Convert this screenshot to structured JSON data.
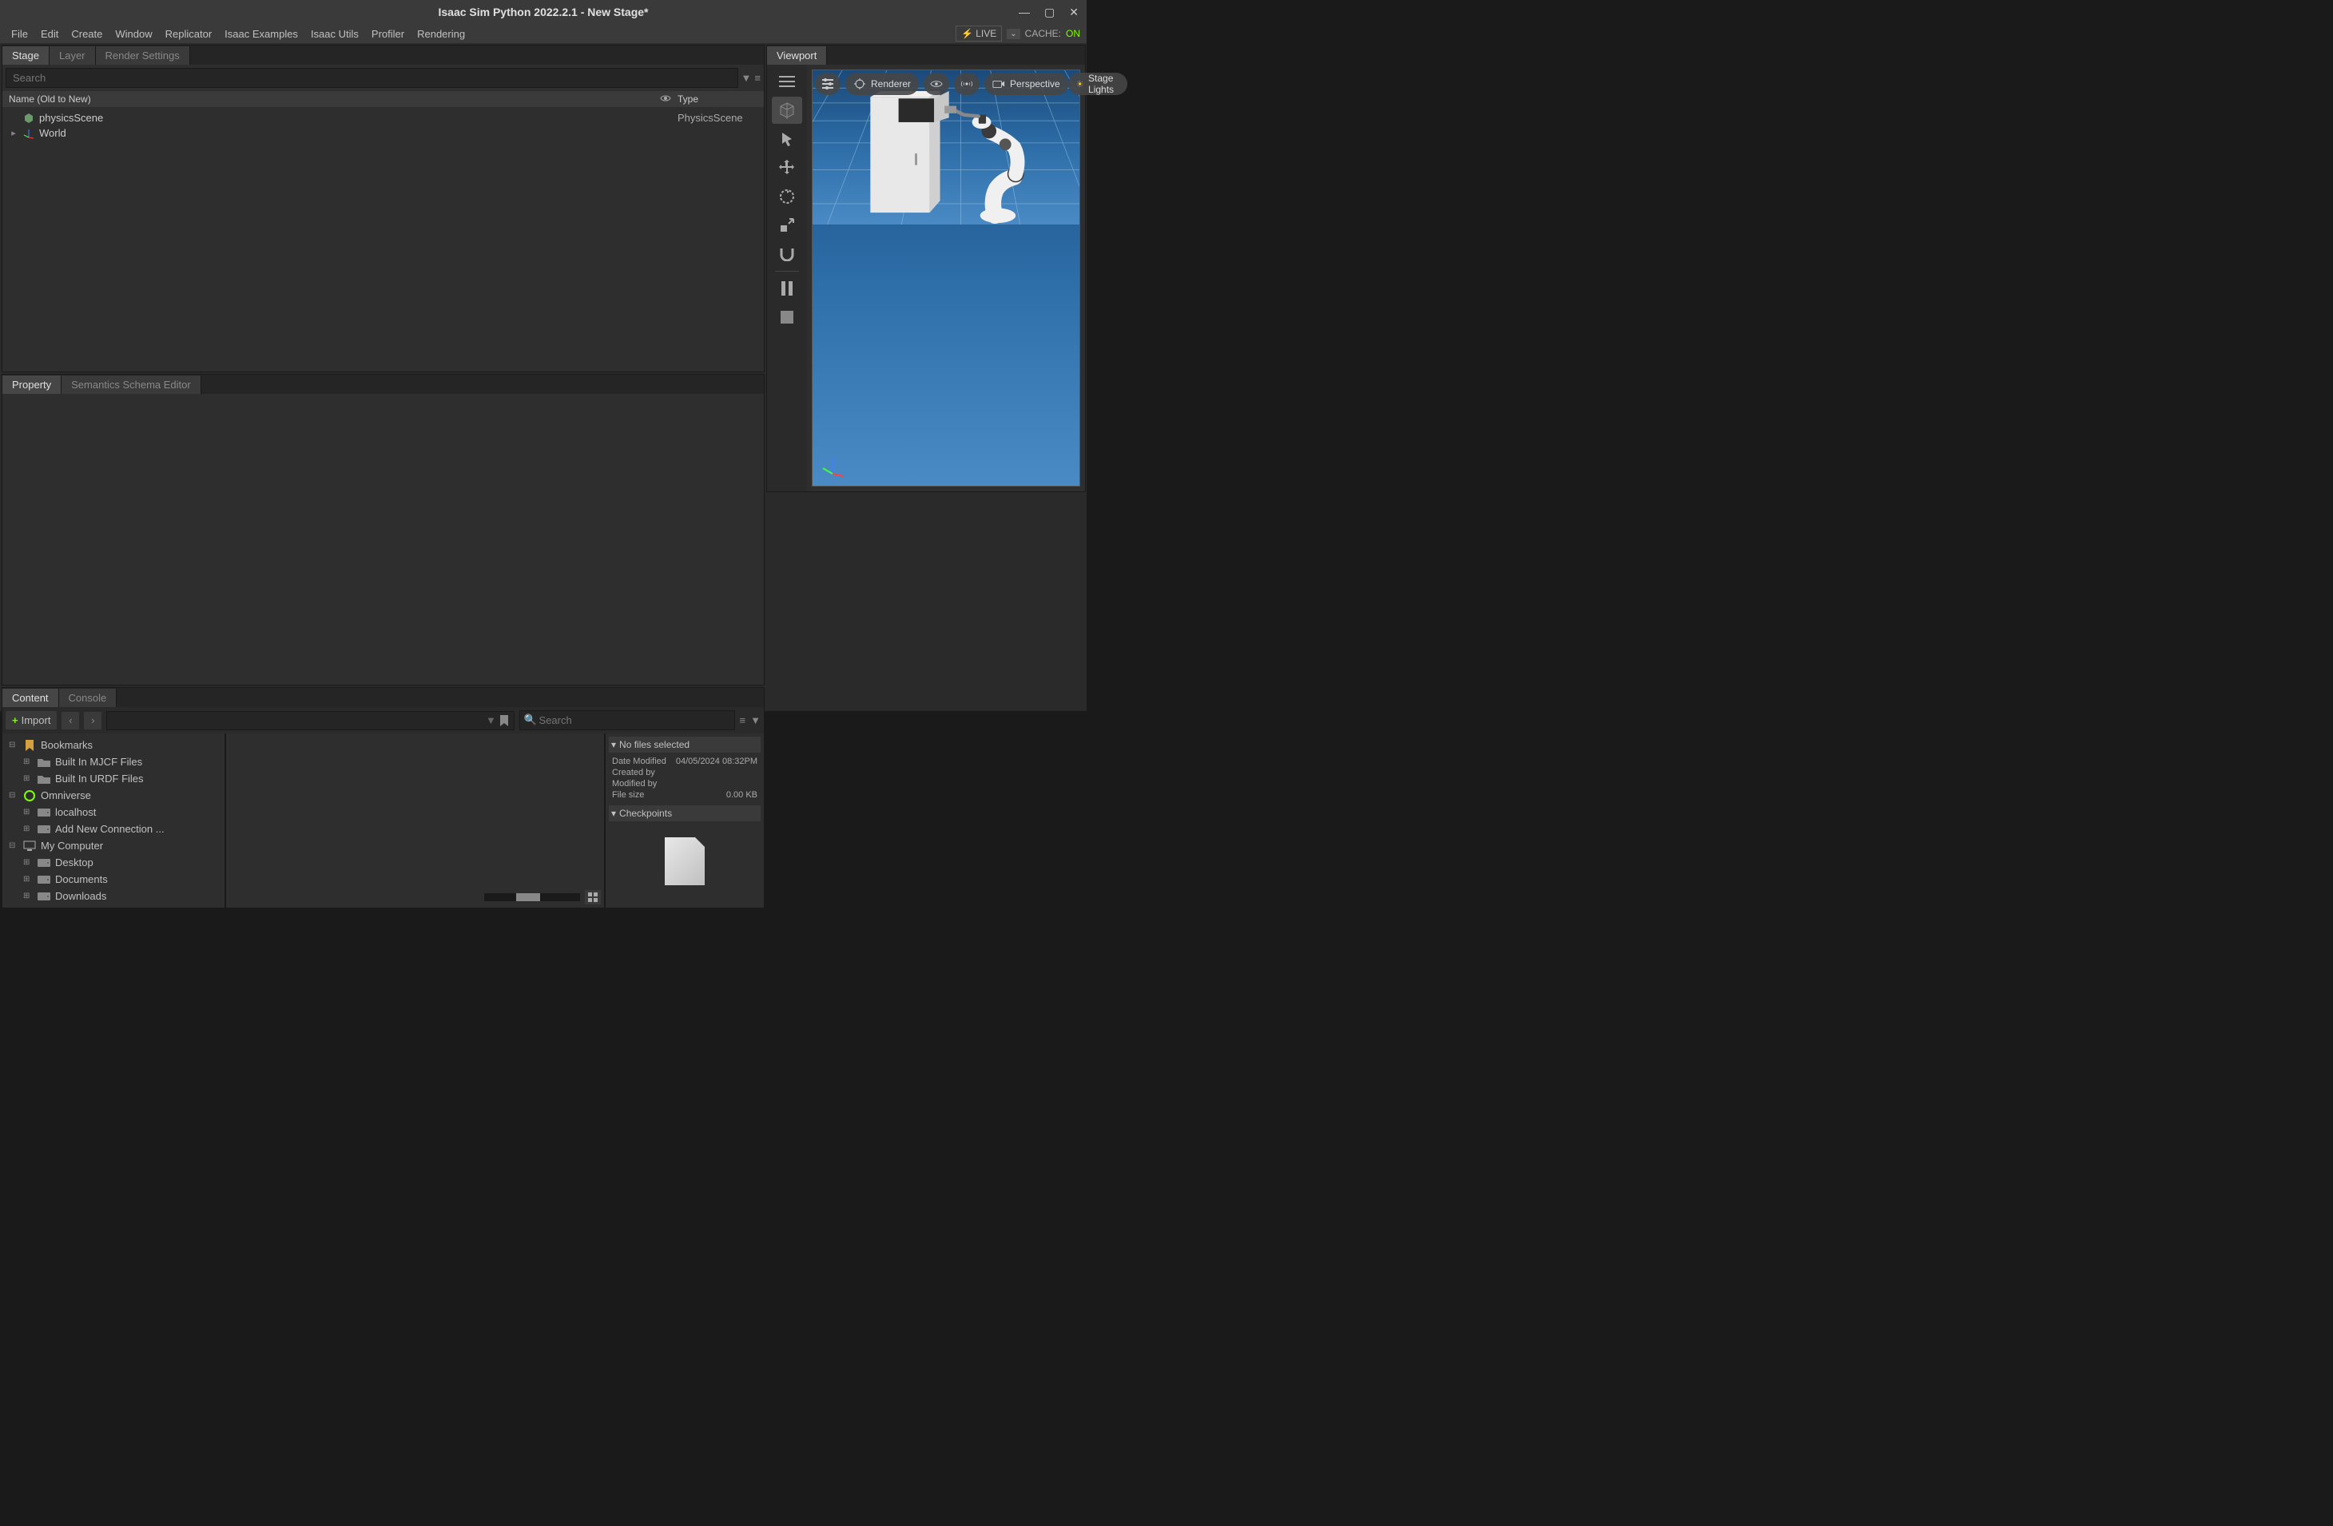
{
  "window": {
    "title": "Isaac Sim Python 2022.2.1 - New Stage*"
  },
  "menubar": {
    "items": [
      "File",
      "Edit",
      "Create",
      "Window",
      "Replicator",
      "Isaac Examples",
      "Isaac Utils",
      "Profiler",
      "Rendering"
    ],
    "live_label": "LIVE",
    "cache_label": "CACHE:",
    "cache_status": "ON"
  },
  "viewport": {
    "tab": "Viewport",
    "renderer_btn": "Renderer",
    "perspective_btn": "Perspective",
    "stage_lights_btn": "Stage Lights"
  },
  "stage_panel": {
    "tabs": [
      "Stage",
      "Layer",
      "Render Settings"
    ],
    "search_placeholder": "Search",
    "col_name": "Name (Old to New)",
    "col_type": "Type",
    "rows": [
      {
        "name": "physicsScene",
        "type": "PhysicsScene",
        "icon": "box"
      },
      {
        "name": "World",
        "type": "",
        "icon": "axes",
        "expandable": true
      }
    ]
  },
  "property_panel": {
    "tabs": [
      "Property",
      "Semantics Schema Editor"
    ]
  },
  "content_panel": {
    "tabs": [
      "Content",
      "Console"
    ],
    "import_btn": "Import",
    "search_placeholder": "Search",
    "tree": [
      {
        "label": "Bookmarks",
        "icon": "bookmark",
        "expanded": true,
        "level": 0
      },
      {
        "label": "Built In MJCF Files",
        "icon": "folder",
        "expandable": true,
        "level": 1
      },
      {
        "label": "Built In URDF Files",
        "icon": "folder",
        "expandable": true,
        "level": 1
      },
      {
        "label": "Omniverse",
        "icon": "omni",
        "expanded": true,
        "level": 0
      },
      {
        "label": "localhost",
        "icon": "drive",
        "expandable": true,
        "level": 1
      },
      {
        "label": "Add New Connection ...",
        "icon": "drive",
        "expandable": true,
        "level": 1
      },
      {
        "label": "My Computer",
        "icon": "computer",
        "expanded": true,
        "level": 0
      },
      {
        "label": "Desktop",
        "icon": "drive",
        "expandable": true,
        "level": 1
      },
      {
        "label": "Documents",
        "icon": "drive",
        "expandable": true,
        "level": 1
      },
      {
        "label": "Downloads",
        "icon": "drive",
        "expandable": true,
        "level": 1
      }
    ],
    "details": {
      "no_files": "No files selected",
      "date_modified_label": "Date Modified",
      "date_modified_value": "04/05/2024 08:32PM",
      "created_by_label": "Created by",
      "modified_by_label": "Modified by",
      "file_size_label": "File size",
      "file_size_value": "0.00 KB",
      "checkpoints_label": "Checkpoints"
    }
  }
}
